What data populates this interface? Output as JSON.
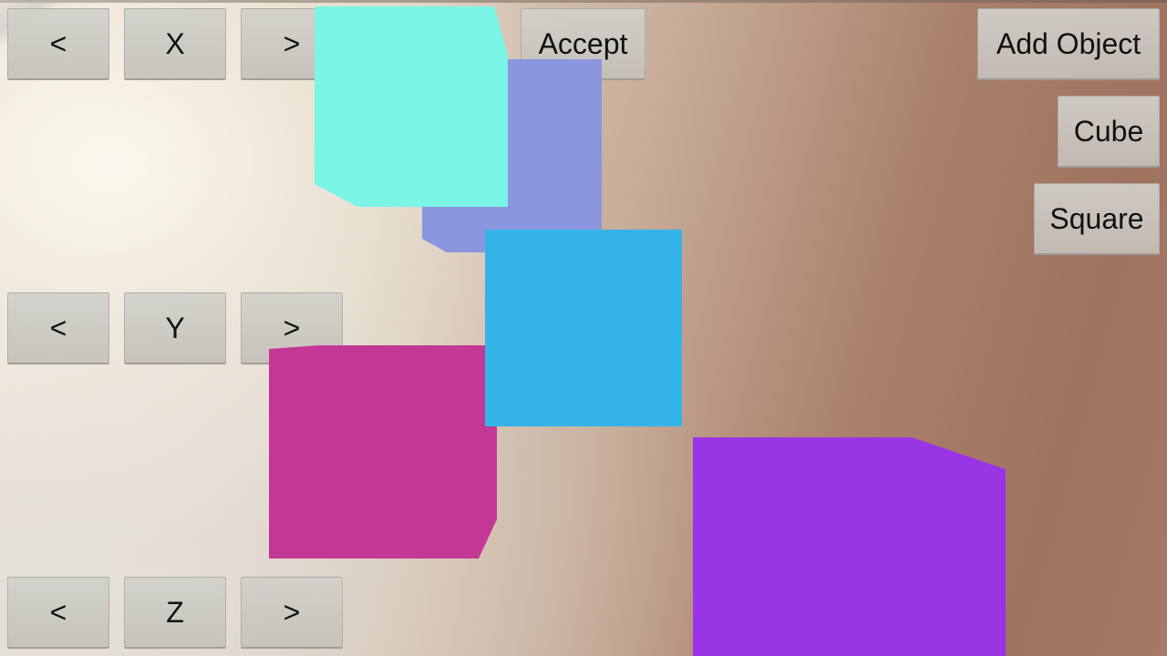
{
  "controls": {
    "x_axis": {
      "decrease": "<",
      "label": "X",
      "increase": ">"
    },
    "y_axis": {
      "decrease": "<",
      "label": "Y",
      "increase": ">"
    },
    "z_axis": {
      "decrease": "<",
      "label": "Z",
      "increase": ">"
    },
    "accept": "Accept"
  },
  "toolbar": {
    "add_object": "Add Object",
    "cube": "Cube",
    "square": "Square"
  },
  "scene_objects": [
    {
      "name": "mint-cube",
      "color": "#7af5e6"
    },
    {
      "name": "lavender-cube",
      "color": "#8a96de"
    },
    {
      "name": "sky-blue-square",
      "color": "#34b4e6"
    },
    {
      "name": "magenta-cube",
      "color": "#c33895"
    },
    {
      "name": "purple-cube",
      "color": "#9a35e6"
    }
  ]
}
